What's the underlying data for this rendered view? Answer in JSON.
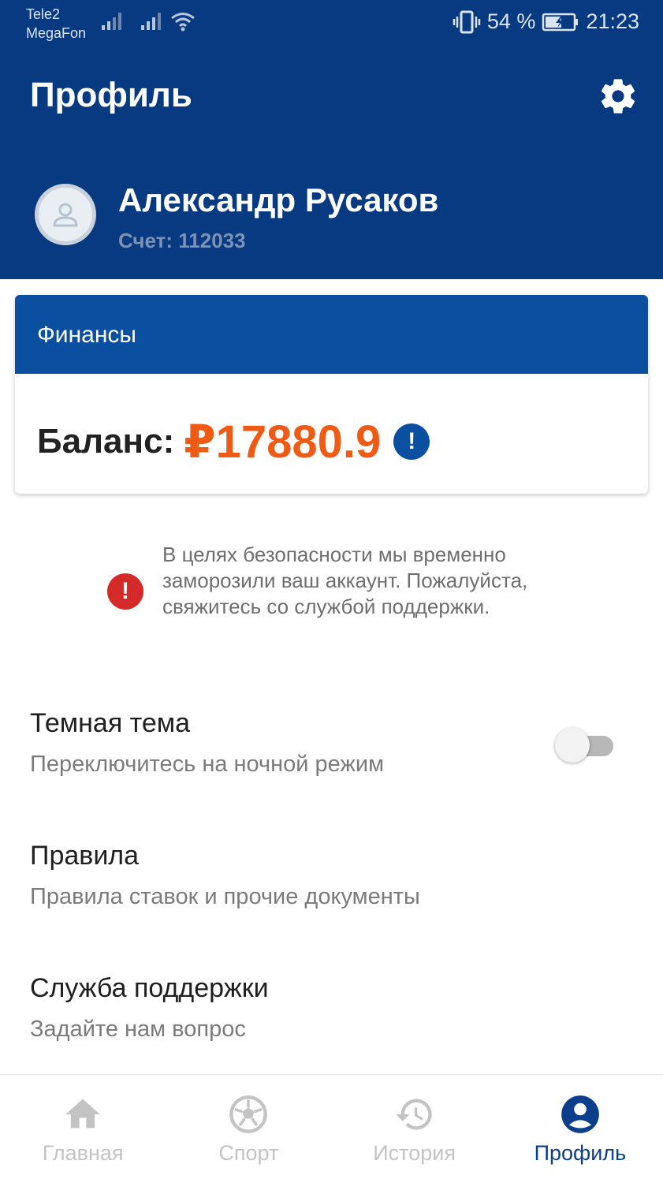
{
  "status_bar": {
    "carrier_1": "Tele2",
    "carrier_2": "MegaFon",
    "battery": "54 %",
    "time": "21:23"
  },
  "header": {
    "title": "Профиль",
    "user_name": "Александр Русаков",
    "account": "Счет: 112033"
  },
  "finance": {
    "title": "Финансы",
    "balance_label": "Баланс:",
    "balance_value": "₽17880.9",
    "info_mark": "!"
  },
  "warning": {
    "icon_mark": "!",
    "text": "В целях безопасности мы временно заморозили ваш аккаунт. Пожалуйста, свяжитесь со службой поддержки."
  },
  "settings": [
    {
      "title": "Темная тема",
      "subtitle": "Переключитесь на ночной режим",
      "toggle_on": false
    },
    {
      "title": "Правила",
      "subtitle": "Правила ставок и прочие документы"
    },
    {
      "title": "Служба поддержки",
      "subtitle": "Задайте нам вопрос"
    }
  ],
  "nav": [
    {
      "label": "Главная",
      "icon": "home-icon"
    },
    {
      "label": "Спорт",
      "icon": "soccer-ball-icon"
    },
    {
      "label": "История",
      "icon": "history-icon"
    },
    {
      "label": "Профиль",
      "icon": "profile-icon",
      "active": true
    }
  ],
  "colors": {
    "header_bg": "#073a80",
    "finance_header_bg": "#0b4fa0",
    "balance": "#ef5a14",
    "warning": "#d52a2a",
    "nav_active": "#0b3f8c",
    "nav_inactive": "#c3c3c3"
  }
}
